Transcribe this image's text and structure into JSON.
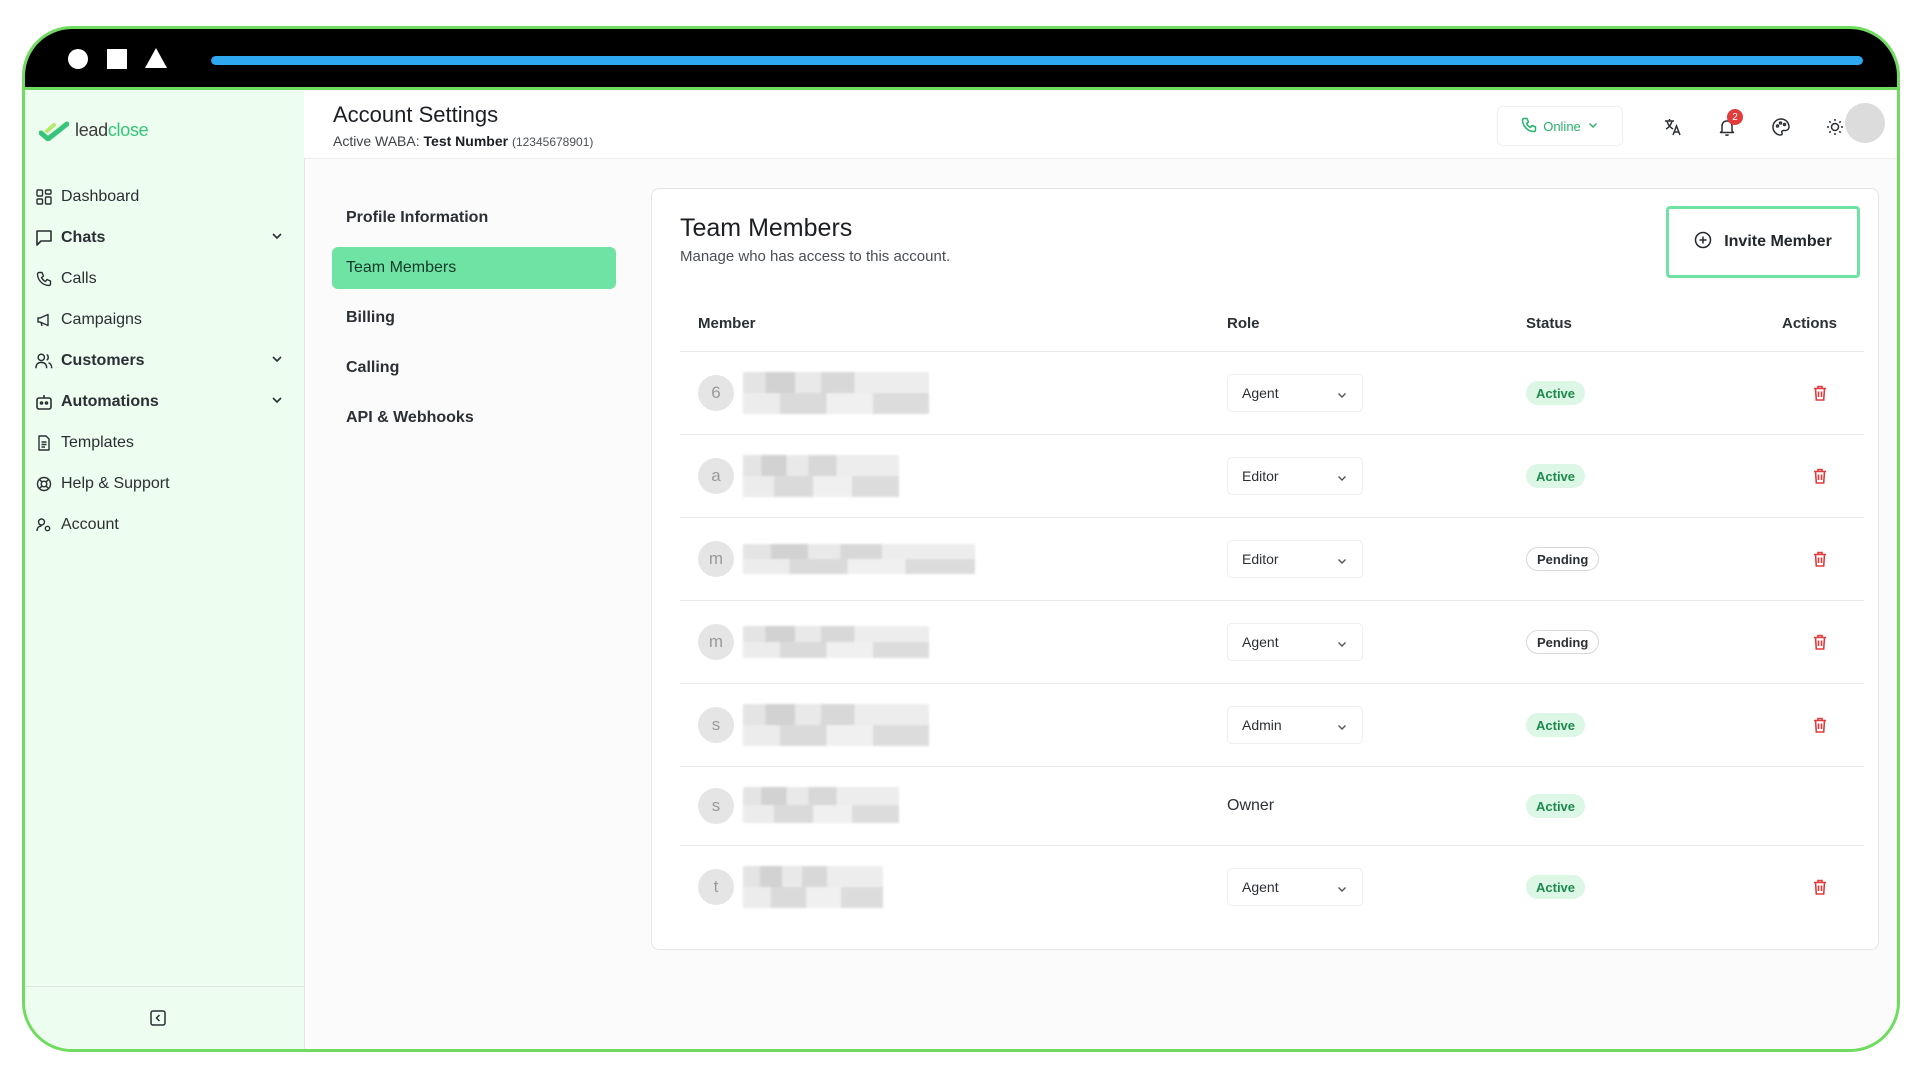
{
  "browser": {
    "progress": 1.0
  },
  "brand": {
    "logo_part1": "lead",
    "logo_part2": "close"
  },
  "sidebar": {
    "items": [
      {
        "label": "Dashboard",
        "icon": "dashboard-icon"
      },
      {
        "label": "Chats",
        "icon": "chat-icon",
        "expandable": true
      },
      {
        "label": "Calls",
        "icon": "phone-icon"
      },
      {
        "label": "Campaigns",
        "icon": "megaphone-icon"
      },
      {
        "label": "Customers",
        "icon": "users-icon",
        "expandable": true
      },
      {
        "label": "Automations",
        "icon": "bot-icon",
        "expandable": true
      },
      {
        "label": "Templates",
        "icon": "document-icon"
      },
      {
        "label": "Help & Support",
        "icon": "lifebuoy-icon"
      },
      {
        "label": "Account",
        "icon": "user-cog-icon"
      }
    ]
  },
  "header": {
    "title": "Account Settings",
    "sub_prefix": "Active WABA:",
    "waba_name": "Test Number",
    "waba_number": "(12345678901)",
    "status_label": "Online",
    "notifications_count": "2",
    "colors": {
      "accent": "#6fe3a4",
      "online": "#27b36a",
      "danger": "#e23b3b"
    }
  },
  "settings_nav": [
    {
      "label": "Profile Information",
      "active": false
    },
    {
      "label": "Team Members",
      "active": true
    },
    {
      "label": "Billing",
      "active": false
    },
    {
      "label": "Calling",
      "active": false
    },
    {
      "label": "API & Webhooks",
      "active": false
    }
  ],
  "team": {
    "title": "Team Members",
    "subtitle": "Manage who has access to this account.",
    "invite_label": "Invite Member",
    "columns": {
      "member": "Member",
      "role": "Role",
      "status": "Status",
      "actions": "Actions"
    },
    "rows": [
      {
        "initial": "6",
        "role": "Agent",
        "status": "Active",
        "editable": true
      },
      {
        "initial": "a",
        "role": "Editor",
        "status": "Active",
        "editable": true
      },
      {
        "initial": "m",
        "role": "Editor",
        "status": "Pending",
        "editable": true
      },
      {
        "initial": "m",
        "role": "Agent",
        "status": "Pending",
        "editable": true
      },
      {
        "initial": "s",
        "role": "Admin",
        "status": "Active",
        "editable": true
      },
      {
        "initial": "s",
        "role": "Owner",
        "status": "Active",
        "editable": false
      },
      {
        "initial": "t",
        "role": "Agent",
        "status": "Active",
        "editable": true
      }
    ]
  }
}
